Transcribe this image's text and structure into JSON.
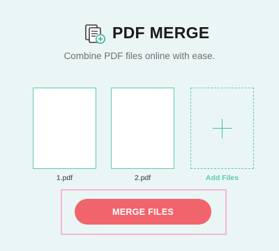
{
  "header": {
    "logo_icon": "pdf-documents-merge-icon",
    "title": "PDF MERGE",
    "subtitle": "Combine PDF files online with ease."
  },
  "files": [
    {
      "name": "1.pdf"
    },
    {
      "name": "2.pdf"
    }
  ],
  "add_files": {
    "label": "Add Files",
    "icon": "plus-icon"
  },
  "actions": {
    "merge_label": "MERGE FILES"
  },
  "colors": {
    "background": "#eaf6f6",
    "accent": "#59c9b3",
    "merge_button": "#f1646b",
    "highlight_outline": "#f2b6d3"
  }
}
